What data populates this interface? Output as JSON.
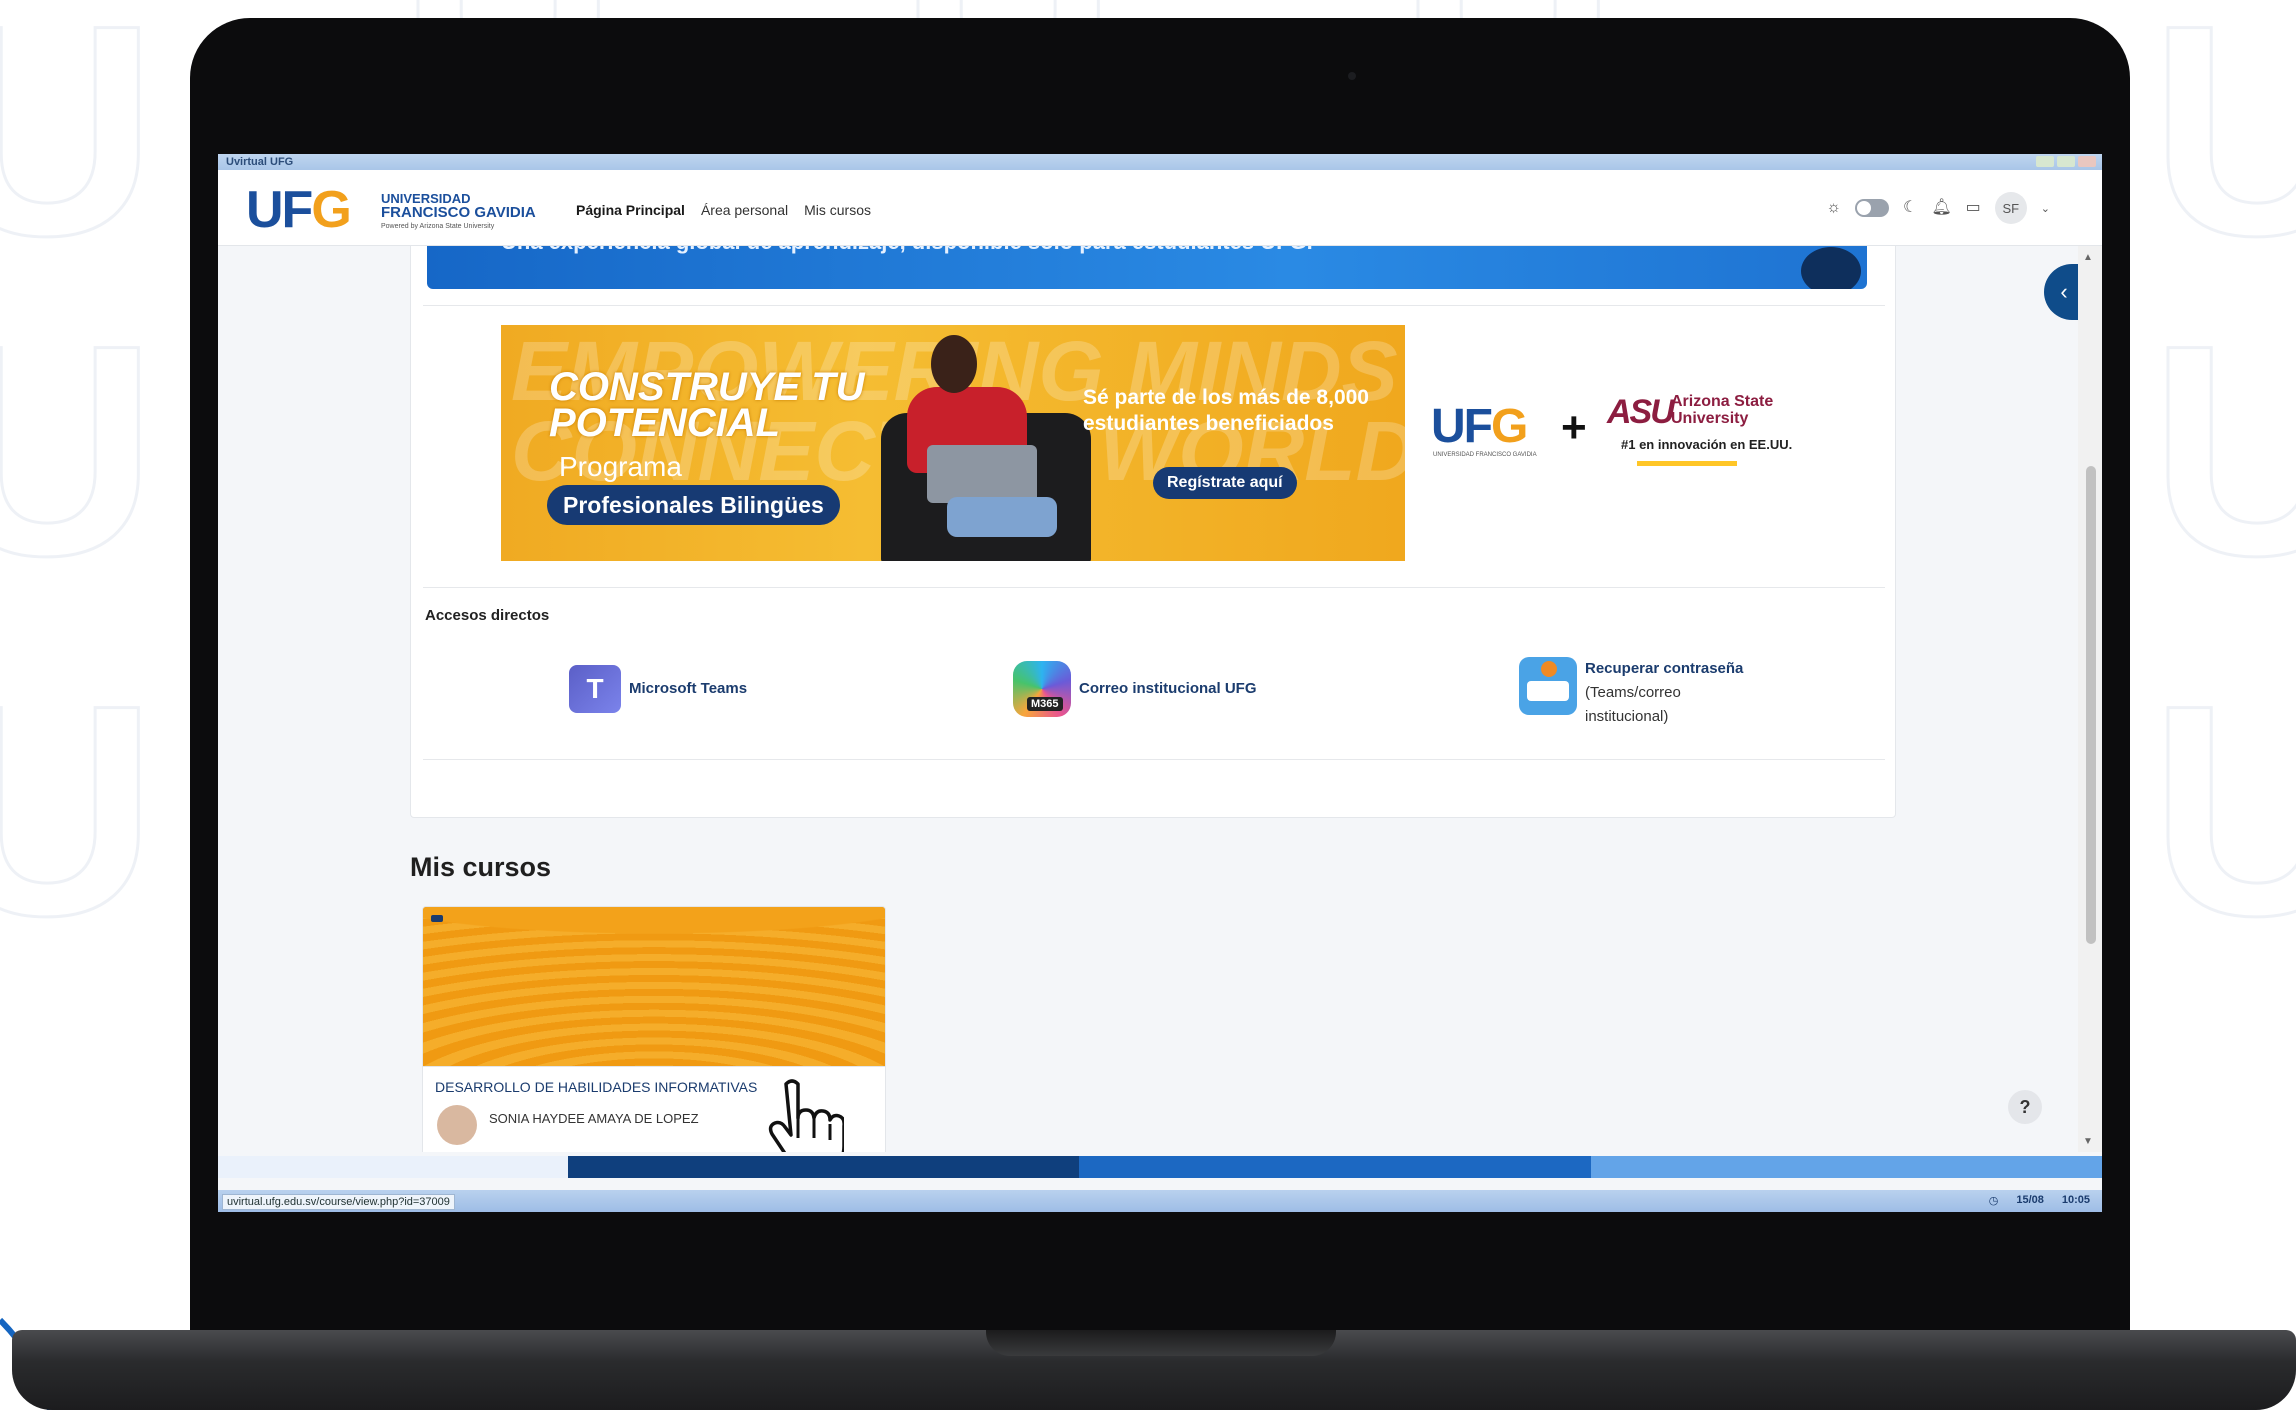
{
  "browser": {
    "window_title": "Uvirtual UFG",
    "status_url": "uvirtual.ufg.edu.sv/course/view.php?id=37009",
    "status_date": "15/08",
    "status_time": "10:05"
  },
  "navbar": {
    "logo_mark": "UF",
    "logo_mark_g": "G",
    "logo_line1": "UNIVERSIDAD",
    "logo_line2": "FRANCISCO GAVIDIA",
    "logo_line3": "Powered by Arizona State University",
    "links": [
      "Página Principal",
      "Área personal",
      "Mis cursos"
    ],
    "avatar_initials": "SF"
  },
  "top_banner": {
    "text": "Una experiencia global de aprendizaje, disponible solo para estudiantes UFG."
  },
  "promo": {
    "bg_text_1": "EMPOWERING MINDS",
    "bg_text_2": "CONNECTING WORLDS",
    "title_1": "CONSTRUYE TU",
    "title_2": "POTENCIAL",
    "programa": "Programa",
    "program_name": "Profesionales Bilingües",
    "subtitle_1": "Sé parte de los más de 8,000",
    "subtitle_2": "estudiantes beneficiados",
    "cta": "Regístrate aquí",
    "partner_ufg_mark": "UF",
    "partner_ufg_g": "G",
    "partner_ufg_sub": "UNIVERSIDAD FRANCISCO GAVIDIA",
    "plus": "+",
    "asu_mark": "ASU",
    "asu_name_1": "Arizona State",
    "asu_name_2": "University",
    "asu_rank": "#1 en innovación en EE.UU."
  },
  "accesos": {
    "label": "Accesos directos",
    "items": [
      {
        "label": "Microsoft Teams",
        "icon": "microsoft-teams-icon"
      },
      {
        "label": "Correo institucional UFG",
        "icon": "microsoft-365-icon",
        "tag": "M365"
      },
      {
        "label": "Recuperar contraseña",
        "sub_1": "(Teams/correo",
        "sub_2": "institucional)",
        "icon": "password-recovery-icon"
      }
    ]
  },
  "mis_cursos": {
    "title": "Mis cursos",
    "courses": [
      {
        "name": "DESARROLLO DE HABILIDADES INFORMATIVAS",
        "teacher": "SONIA HAYDEE AMAYA DE LOPEZ"
      }
    ]
  },
  "help": "?",
  "colors": {
    "brand_blue": "#1b4f9c",
    "brand_orange": "#f2a01c",
    "navy": "#173a73",
    "asu_maroon": "#8c1d40"
  }
}
